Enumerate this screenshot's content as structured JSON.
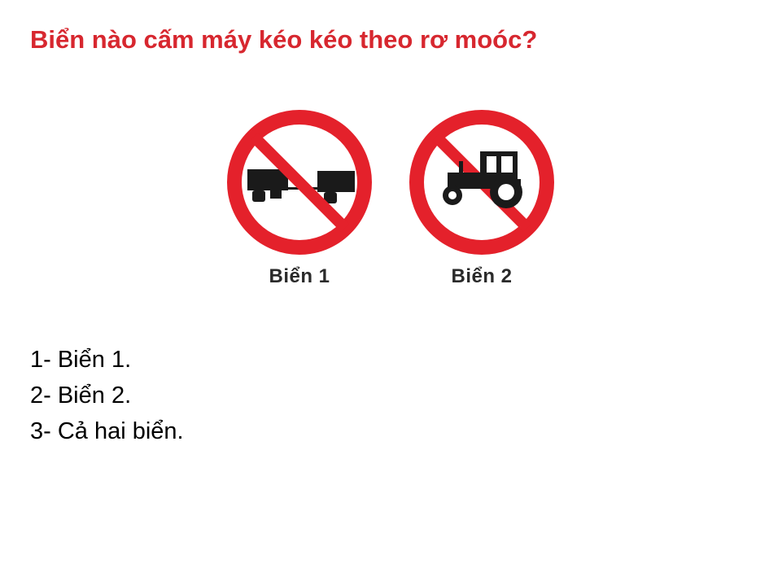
{
  "question": {
    "text": "Biển nào cấm máy kéo kéo theo rơ moóc?"
  },
  "signs": [
    {
      "label": "Biển 1",
      "icon": "tractor-trailer-icon"
    },
    {
      "label": "Biển 2",
      "icon": "tractor-icon"
    }
  ],
  "answers": [
    {
      "text": "1- Biển 1."
    },
    {
      "text": "2- Biển 2."
    },
    {
      "text": "3- Cả hai biển."
    }
  ],
  "colors": {
    "question": "#d7272f",
    "sign_red": "#e4212b",
    "sign_black": "#1a1a1a",
    "answer_text": "#000000"
  }
}
